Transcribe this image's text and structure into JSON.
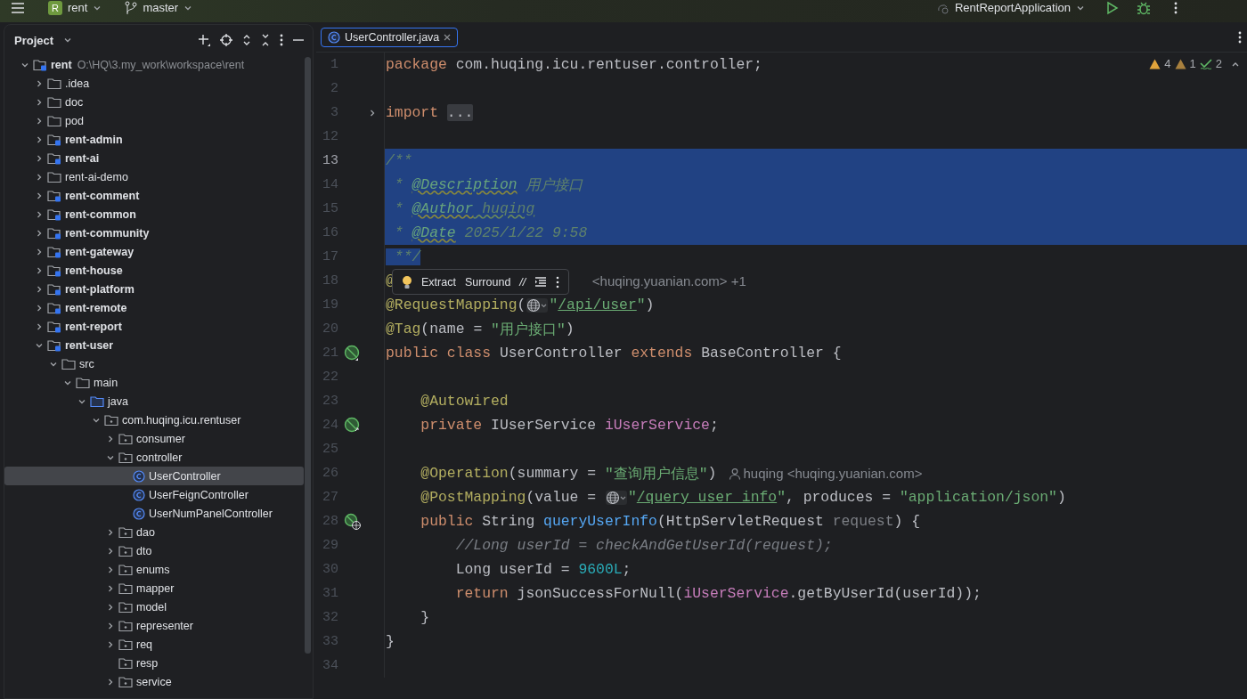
{
  "toolbar": {
    "project_letter": "R",
    "project": "rent",
    "branch": "master",
    "run_config": "RentReportApplication"
  },
  "project_panel": {
    "title": "Project",
    "tree": [
      {
        "name": "rent",
        "path": "O:\\HQ\\3.my_work\\workspace\\rent",
        "kind": "module",
        "expanded": true,
        "selected": false,
        "children": [
          {
            "name": ".idea",
            "kind": "folder",
            "expanded": false,
            "selected": false
          },
          {
            "name": "doc",
            "kind": "folder",
            "expanded": false,
            "selected": false
          },
          {
            "name": "pod",
            "kind": "folder",
            "expanded": false,
            "selected": false
          },
          {
            "name": "rent-admin",
            "kind": "module",
            "expanded": false,
            "selected": false
          },
          {
            "name": "rent-ai",
            "kind": "module",
            "expanded": false,
            "selected": false
          },
          {
            "name": "rent-ai-demo",
            "kind": "folder",
            "expanded": false,
            "selected": false
          },
          {
            "name": "rent-comment",
            "kind": "module",
            "expanded": false,
            "selected": false
          },
          {
            "name": "rent-common",
            "kind": "module",
            "expanded": false,
            "selected": false
          },
          {
            "name": "rent-community",
            "kind": "module",
            "expanded": false,
            "selected": false
          },
          {
            "name": "rent-gateway",
            "kind": "module",
            "expanded": false,
            "selected": false
          },
          {
            "name": "rent-house",
            "kind": "module",
            "expanded": false,
            "selected": false
          },
          {
            "name": "rent-platform",
            "kind": "module",
            "expanded": false,
            "selected": false
          },
          {
            "name": "rent-remote",
            "kind": "module",
            "expanded": false,
            "selected": false
          },
          {
            "name": "rent-report",
            "kind": "module",
            "expanded": false,
            "selected": false
          },
          {
            "name": "rent-user",
            "kind": "module",
            "expanded": true,
            "selected": false,
            "children": [
              {
                "name": "src",
                "kind": "folder",
                "expanded": true,
                "selected": false,
                "children": [
                  {
                    "name": "main",
                    "kind": "folder",
                    "expanded": true,
                    "selected": false,
                    "children": [
                      {
                        "name": "java",
                        "kind": "source",
                        "expanded": true,
                        "selected": false,
                        "children": [
                          {
                            "name": "com.huqing.icu.rentuser",
                            "kind": "package",
                            "expanded": true,
                            "selected": false,
                            "children": [
                              {
                                "name": "consumer",
                                "kind": "package",
                                "expanded": false,
                                "selected": false
                              },
                              {
                                "name": "controller",
                                "kind": "package",
                                "expanded": true,
                                "selected": false,
                                "children": [
                                  {
                                    "name": "UserController",
                                    "kind": "class",
                                    "selected": true
                                  },
                                  {
                                    "name": "UserFeignController",
                                    "kind": "class",
                                    "selected": false
                                  },
                                  {
                                    "name": "UserNumPanelController",
                                    "kind": "class",
                                    "selected": false
                                  }
                                ]
                              },
                              {
                                "name": "dao",
                                "kind": "package",
                                "expanded": false,
                                "selected": false
                              },
                              {
                                "name": "dto",
                                "kind": "package",
                                "expanded": false,
                                "selected": false
                              },
                              {
                                "name": "enums",
                                "kind": "package",
                                "expanded": false,
                                "selected": false
                              },
                              {
                                "name": "mapper",
                                "kind": "package",
                                "expanded": false,
                                "selected": false
                              },
                              {
                                "name": "model",
                                "kind": "package",
                                "expanded": false,
                                "selected": false
                              },
                              {
                                "name": "representer",
                                "kind": "package",
                                "expanded": false,
                                "selected": false
                              },
                              {
                                "name": "req",
                                "kind": "package",
                                "expanded": false,
                                "selected": false
                              },
                              {
                                "name": "resp",
                                "kind": "package",
                                "selected": false
                              },
                              {
                                "name": "service",
                                "kind": "package",
                                "expanded": false,
                                "selected": false
                              }
                            ]
                          }
                        ]
                      }
                    ]
                  }
                ]
              }
            ]
          }
        ]
      }
    ]
  },
  "editor": {
    "tabs": [
      {
        "label": "UserController.java",
        "selected": true
      }
    ],
    "inspections": {
      "warnings": "4",
      "weak_warnings": "1",
      "typos": "2"
    },
    "lines": [
      {
        "number": "1",
        "tokens": [
          {
            "kind": "kw",
            "text": "package"
          },
          {
            "kind": "plain",
            "text": " com.huqing.icu.rentuser.controller;"
          }
        ]
      },
      {
        "number": "2"
      },
      {
        "number": "3",
        "fold": true,
        "tokens": [
          {
            "kind": "kw",
            "text": "import "
          },
          {
            "kind": "folded",
            "text": "..."
          }
        ]
      },
      {
        "number": "12"
      },
      {
        "number": "13",
        "selected": true,
        "current": true,
        "tokens": [
          {
            "kind": "doc",
            "text": "/**"
          }
        ]
      },
      {
        "number": "14",
        "selected": true,
        "tokens": [
          {
            "kind": "doc",
            "text": " * "
          },
          {
            "kind": "doctag",
            "text": "@Description"
          },
          {
            "kind": "doc",
            "text": " 用户接口"
          }
        ]
      },
      {
        "number": "15",
        "selected": true,
        "tokens": [
          {
            "kind": "doc",
            "text": " * "
          },
          {
            "kind": "doctag",
            "text": "@Author"
          },
          {
            "kind": "doctypo",
            "text": " huqing"
          }
        ]
      },
      {
        "number": "16",
        "selected": true,
        "tokens": [
          {
            "kind": "doc",
            "text": " * "
          },
          {
            "kind": "doctag",
            "text": "@Date"
          },
          {
            "kind": "doc",
            "text": " 2025/1/22 9:58"
          }
        ]
      },
      {
        "number": "17",
        "selected": false,
        "tokens": [
          {
            "kind": "doc",
            "text": " **/",
            "selected": true
          }
        ]
      },
      {
        "number": "18",
        "popup": {
          "actions": [
            "Extract",
            "Surround"
          ],
          "comment": "//"
        },
        "tokens": [
          {
            "kind": "ann",
            "text": "@"
          },
          {
            "kind": "hint-tail",
            "text": "<huqing.yuanian.com> +1"
          }
        ]
      },
      {
        "number": "19",
        "tokens": [
          {
            "kind": "ann",
            "text": "@RequestMapping"
          },
          {
            "kind": "plain",
            "text": "("
          },
          {
            "kind": "globe"
          },
          {
            "kind": "str",
            "text": "\""
          },
          {
            "kind": "url",
            "text": "/api/user"
          },
          {
            "kind": "str",
            "text": "\""
          },
          {
            "kind": "plain",
            "text": ")"
          }
        ]
      },
      {
        "number": "20",
        "tokens": [
          {
            "kind": "ann",
            "text": "@Tag"
          },
          {
            "kind": "plain",
            "text": "(name = "
          },
          {
            "kind": "str",
            "text": "\"用户接口\""
          },
          {
            "kind": "plain",
            "text": ")"
          }
        ]
      },
      {
        "number": "21",
        "gutter": {
          "kind": "bean"
        },
        "tokens": [
          {
            "kind": "kw",
            "text": "public class "
          },
          {
            "kind": "plain",
            "text": "UserController "
          },
          {
            "kind": "kw",
            "text": "extends "
          },
          {
            "kind": "plain",
            "text": "BaseController {"
          }
        ]
      },
      {
        "number": "22"
      },
      {
        "number": "23",
        "tokens": [
          {
            "kind": "ann",
            "text": "    @Autowired"
          }
        ]
      },
      {
        "number": "24",
        "gutter": {
          "kind": "bean-link"
        },
        "tokens": [
          {
            "kind": "kw",
            "text": "    private "
          },
          {
            "kind": "plain",
            "text": "IUserService "
          },
          {
            "kind": "field",
            "text": "iUserService"
          },
          {
            "kind": "plain",
            "text": ";"
          }
        ]
      },
      {
        "number": "25"
      },
      {
        "number": "26",
        "tokens": [
          {
            "kind": "ann",
            "text": "    @Operation"
          },
          {
            "kind": "plain",
            "text": "(summary = "
          },
          {
            "kind": "str",
            "text": "\"查询用户信息\""
          },
          {
            "kind": "plain",
            "text": ")"
          },
          {
            "kind": "author",
            "text": "huqing <huqing.yuanian.com>"
          }
        ]
      },
      {
        "number": "27",
        "tokens": [
          {
            "kind": "ann",
            "text": "    @PostMapping"
          },
          {
            "kind": "plain",
            "text": "(value = "
          },
          {
            "kind": "globe"
          },
          {
            "kind": "str",
            "text": "\""
          },
          {
            "kind": "url",
            "text": "/query_user_info"
          },
          {
            "kind": "str",
            "text": "\""
          },
          {
            "kind": "plain",
            "text": ", produces = "
          },
          {
            "kind": "str",
            "text": "\"application/json\""
          },
          {
            "kind": "plain",
            "text": ")"
          }
        ]
      },
      {
        "number": "28",
        "gutter": {
          "kind": "endpoint"
        },
        "tokens": [
          {
            "kind": "kw",
            "text": "    public "
          },
          {
            "kind": "plain",
            "text": "String "
          },
          {
            "kind": "method",
            "text": "queryUserInfo"
          },
          {
            "kind": "plain",
            "text": "(HttpServletRequest "
          },
          {
            "kind": "param",
            "text": "request"
          },
          {
            "kind": "plain",
            "text": ") {"
          }
        ]
      },
      {
        "number": "29",
        "tokens": [
          {
            "kind": "comment",
            "text": "        //Long userId = checkAndGetUserId(request);"
          }
        ]
      },
      {
        "number": "30",
        "tokens": [
          {
            "kind": "plain",
            "text": "        Long userId = "
          },
          {
            "kind": "num",
            "text": "9600L"
          },
          {
            "kind": "plain",
            "text": ";"
          }
        ]
      },
      {
        "number": "31",
        "tokens": [
          {
            "kind": "kw",
            "text": "        return "
          },
          {
            "kind": "plain",
            "text": "jsonSuccessForNull("
          },
          {
            "kind": "field",
            "text": "iUserService"
          },
          {
            "kind": "plain",
            "text": ".getByUserId(userId));"
          }
        ]
      },
      {
        "number": "32",
        "tokens": [
          {
            "kind": "plain",
            "text": "    }"
          }
        ]
      },
      {
        "number": "33",
        "tokens": [
          {
            "kind": "plain",
            "text": "}"
          }
        ]
      },
      {
        "number": "34"
      }
    ]
  }
}
